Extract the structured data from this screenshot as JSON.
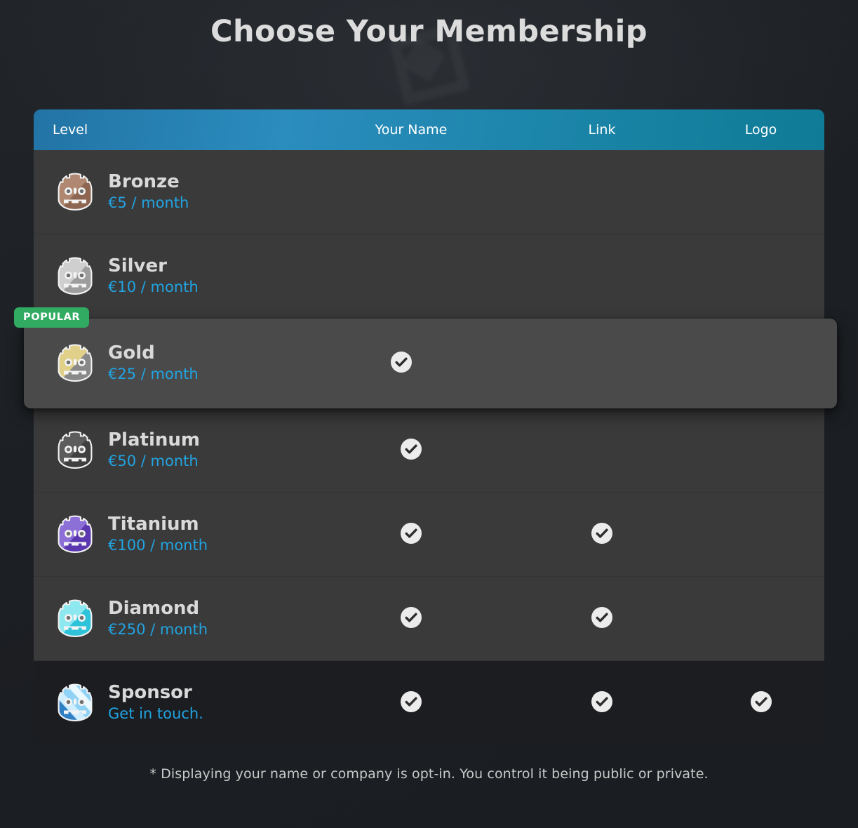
{
  "header": {
    "title": "Choose Your Membership",
    "watermark_icon": "godot-logo-watermark"
  },
  "table": {
    "columns": [
      {
        "key": "level",
        "label": "Level"
      },
      {
        "key": "name",
        "label": "Your Name"
      },
      {
        "key": "link",
        "label": "Link"
      },
      {
        "key": "logo",
        "label": "Logo"
      }
    ],
    "header_gradient": [
      "#2274a5",
      "#0f7b96"
    ],
    "popular_badge": {
      "label": "POPULAR",
      "color": "#32ab62",
      "applies_to": "Gold"
    },
    "rows": [
      {
        "level": "Bronze",
        "price": "€5 / month",
        "icon": "godot-head-bronze",
        "icon_colors": {
          "light": "#b08771",
          "dark": "#8d6550"
        },
        "your_name": false,
        "link": false,
        "logo": false,
        "popular": false,
        "sponsor": false
      },
      {
        "level": "Silver",
        "price": "€10 / month",
        "icon": "godot-head-silver",
        "icon_colors": {
          "light": "#cfcfcf",
          "dark": "#9d9d9d"
        },
        "your_name": false,
        "link": false,
        "logo": false,
        "popular": false,
        "sponsor": false
      },
      {
        "level": "Gold",
        "price": "€25 / month",
        "icon": "godot-head-gold",
        "icon_colors": {
          "light": "#e0d08a",
          "dark": "#b8a košice"
        },
        "your_name": true,
        "link": false,
        "logo": false,
        "popular": true,
        "sponsor": false
      },
      {
        "level": "Platinum",
        "price": "€50 / month",
        "icon": "godot-head-platinum",
        "icon_colors": {
          "light": "#5c5c5c",
          "dark": "#3f3f3f"
        },
        "your_name": true,
        "link": false,
        "logo": false,
        "popular": false,
        "sponsor": false
      },
      {
        "level": "Titanium",
        "price": "€100 / month",
        "icon": "godot-head-titanium",
        "icon_colors": {
          "light": "#8d6fd8",
          "dark": "#5b37b0"
        },
        "your_name": true,
        "link": true,
        "logo": false,
        "popular": false,
        "sponsor": false
      },
      {
        "level": "Diamond",
        "price": "€250 / month",
        "icon": "godot-head-diamond",
        "icon_colors": {
          "light": "#8ee8f0",
          "dark": "#2fc3da"
        },
        "your_name": true,
        "link": true,
        "logo": false,
        "popular": false,
        "sponsor": false
      },
      {
        "level": "Sponsor",
        "price": "Get in touch.",
        "icon": "godot-head-sponsor",
        "icon_colors": {
          "light": "#8fd2f5",
          "dark": "#2f7fc4"
        },
        "your_name": true,
        "link": true,
        "logo": true,
        "popular": false,
        "sponsor": true
      }
    ]
  },
  "footnote": "* Displaying your name or company is opt-in. You control it being public or private.",
  "colors": {
    "page_background": "#212529",
    "row_background": "#3a3a3a",
    "row_highlight": "#4a4a4a",
    "sponsor_row": "#1b1d20",
    "price_accent": "#22a3e0",
    "badge_green": "#32ab62",
    "check_circle": "#ececec"
  }
}
